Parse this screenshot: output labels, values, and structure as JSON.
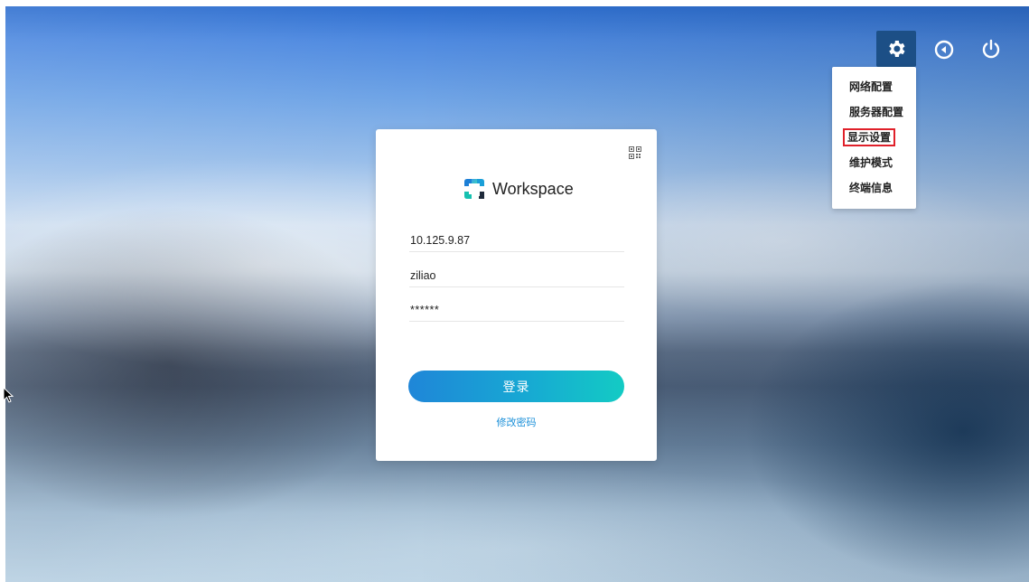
{
  "topbar": {
    "settings_icon": "gear-icon",
    "back_icon": "circle-back-icon",
    "power_icon": "power-icon"
  },
  "settings_menu": {
    "items": [
      {
        "label": "网络配置"
      },
      {
        "label": "服务器配置"
      },
      {
        "label": "显示设置"
      },
      {
        "label": "维护模式"
      },
      {
        "label": "终端信息"
      }
    ],
    "highlighted_index": 2
  },
  "login": {
    "brand_name": "Workspace",
    "server_address": "10.125.9.87",
    "username": "ziliao",
    "password_masked": "******",
    "login_button": "登录",
    "change_password_link": "修改密码"
  },
  "colors": {
    "settings_button_bg": "#1c4f86",
    "login_gradient_start": "#1f86d8",
    "login_gradient_end": "#13cbc4",
    "link": "#1a8fd8",
    "highlight_border": "#e0202a"
  }
}
